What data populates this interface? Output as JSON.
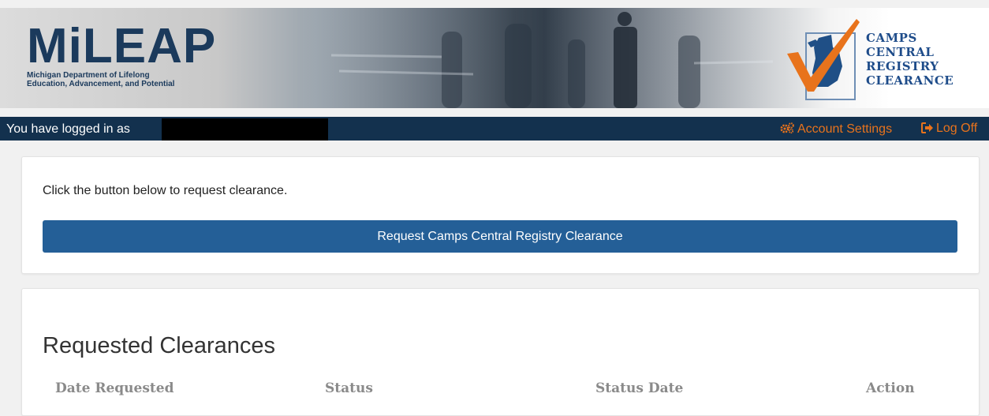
{
  "header": {
    "org_logo_text": "MiLEAP",
    "org_name_line1": "Michigan Department of Lifelong",
    "org_name_line2": "Education, Advancement, and Potential",
    "program_logo_lines": [
      "CAMPS",
      "CENTRAL",
      "REGISTRY",
      "CLEARANCE"
    ]
  },
  "login_bar": {
    "logged_in_label": "You have logged in as",
    "account_settings_label": "Account Settings",
    "account_settings_icon": "gears-icon",
    "log_off_label": "Log Off",
    "log_off_icon": "sign-out-icon",
    "link_color": "#e8731c",
    "bar_color": "#13314e"
  },
  "request_card": {
    "instruction": "Click the button below to request clearance.",
    "button_label": "Request Camps Central Registry Clearance",
    "button_color": "#245f97"
  },
  "clearances": {
    "title": "Requested Clearances",
    "columns": [
      "Date Requested",
      "Status",
      "Status Date",
      "Action"
    ]
  }
}
